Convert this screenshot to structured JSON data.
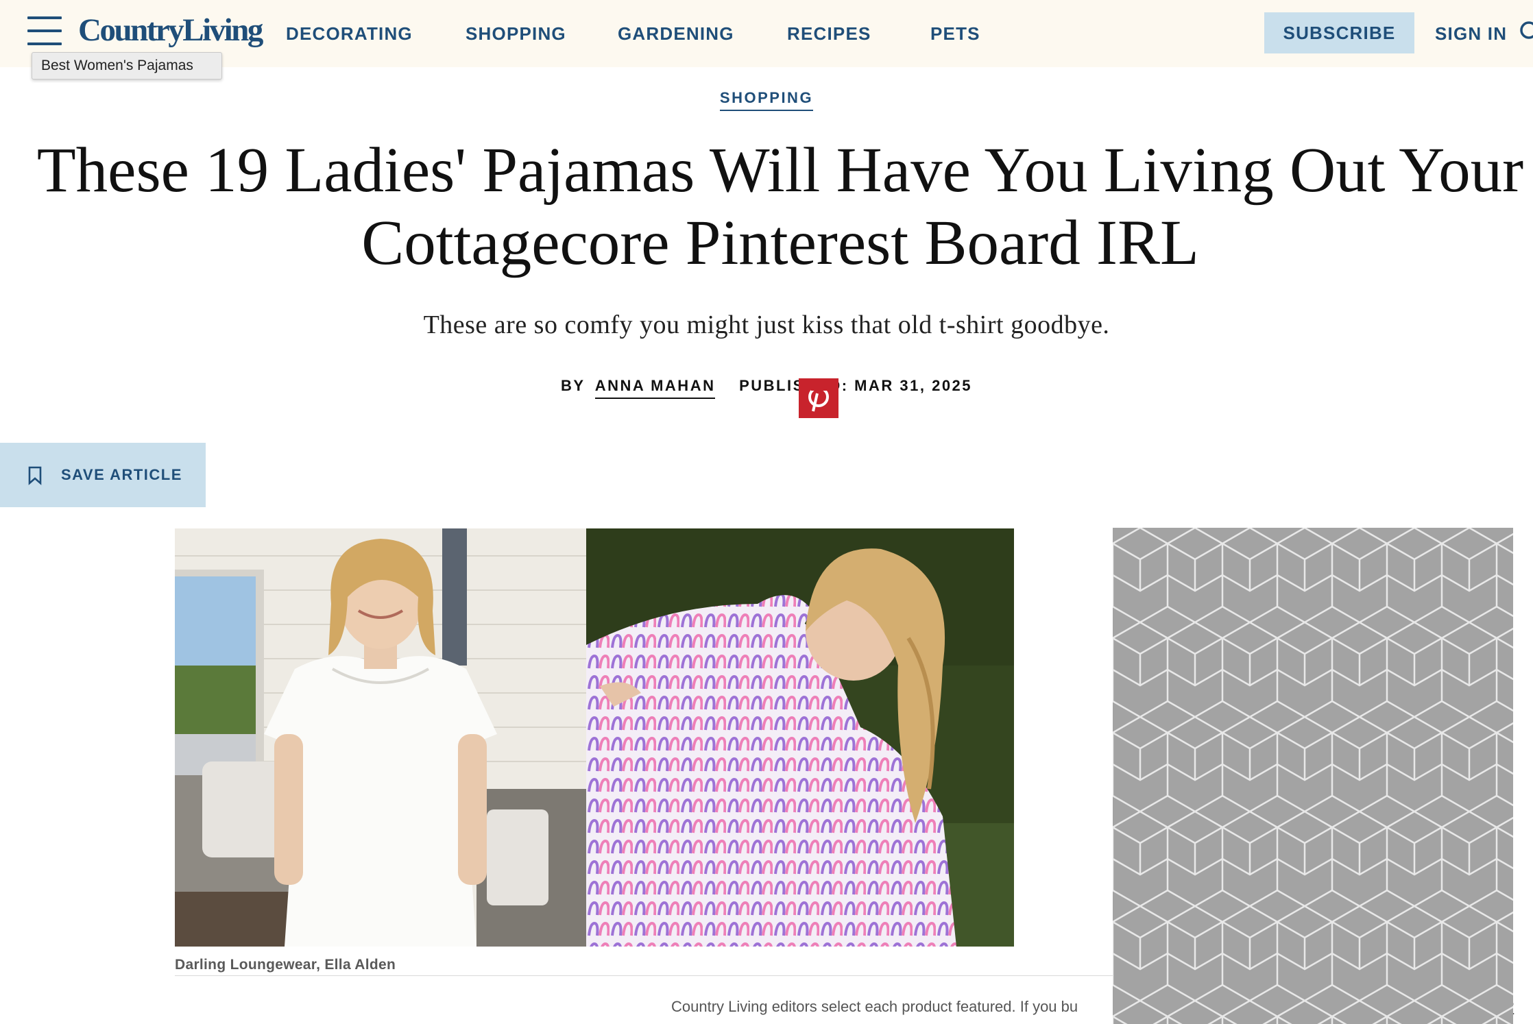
{
  "header": {
    "logo": "CountryLiving",
    "tooltip": "Best Women's Pajamas",
    "nav": [
      "DECORATING",
      "SHOPPING",
      "GARDENING",
      "RECIPES",
      "PETS"
    ],
    "subscribe": "SUBSCRIBE",
    "sign_in": "SIGN IN"
  },
  "article": {
    "section": "SHOPPING",
    "headline_line1": "These 19 Ladies' Pajamas Will Have You Living Out Your",
    "headline_line2": "Cottagecore Pinterest Board IRL",
    "dek": "These are so comfy you might just kiss that old t-shirt goodbye.",
    "by_label": "BY",
    "author": "ANNA MAHAN",
    "published": "PUBLISHED: MAR 31, 2025",
    "save_label": "SAVE ARTICLE",
    "image_caption": "Darling Loungewear, Ella Alden",
    "disclaimer": "Country Living editors select each product featured. If you bu",
    "disclaimer_tail": "?"
  },
  "colors": {
    "brand": "#1f4e79",
    "header_bg": "#fdf9f0",
    "subscribe_bg": "#c9dfec",
    "pinterest": "#c8232c",
    "ad_bg": "#a3a3a3"
  }
}
